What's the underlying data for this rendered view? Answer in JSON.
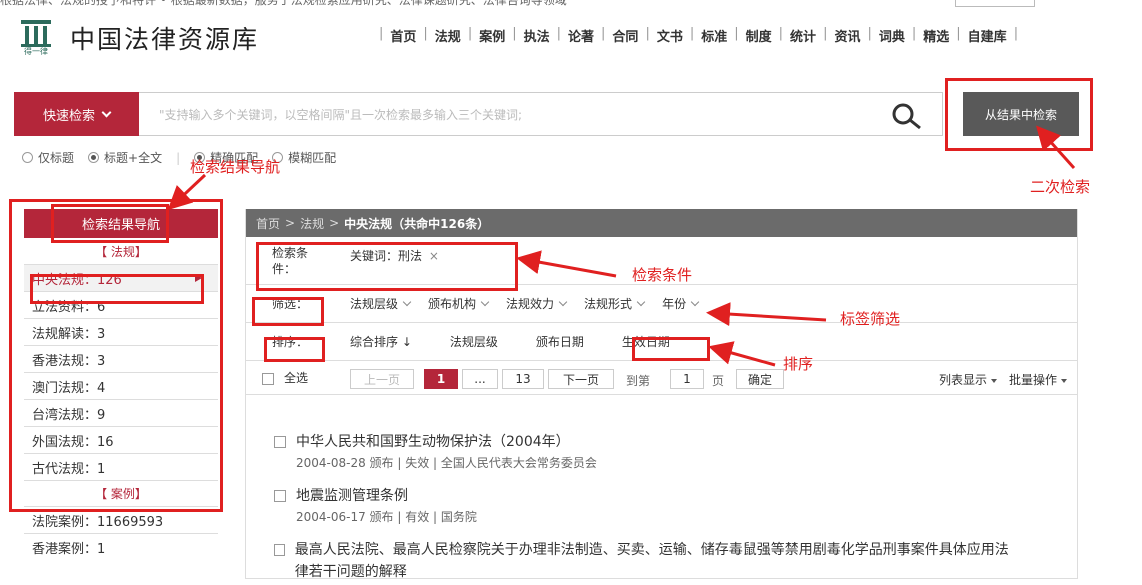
{
  "top_strip": {
    "text": "根据法律、法规的授予和特许 • 根据最新数据，服务于法规检索应用研究、法律课题研究、法律咨询等领域"
  },
  "logo": {
    "subtext": "得一律",
    "name": "中国法律资源库"
  },
  "topnav": [
    "首页",
    "法规",
    "案例",
    "执法",
    "论著",
    "合同",
    "文书",
    "标准",
    "制度",
    "统计",
    "资讯",
    "词典",
    "精选",
    "自建库"
  ],
  "search": {
    "quick_label": "快速检索",
    "placeholder": "\"支持输入多个关键词，以空格间隔\"且一次检索最多输入三个关键词;",
    "secondary_button": "从结果中检索",
    "options": [
      {
        "label": "仅标题",
        "checked": false
      },
      {
        "label": "标题+全文",
        "checked": true
      },
      {
        "label": "精确匹配",
        "checked": true
      },
      {
        "label": "模糊匹配",
        "checked": false
      }
    ]
  },
  "sidebar": {
    "title": "检索结果导航",
    "cat1": "【 法规】",
    "items": [
      {
        "label": "中央法规：126"
      },
      {
        "label": "立法资料：6"
      },
      {
        "label": "法规解读：3"
      },
      {
        "label": "香港法规：3"
      },
      {
        "label": "澳门法规：4"
      },
      {
        "label": "台湾法规：9"
      },
      {
        "label": "外国法规：16"
      },
      {
        "label": "古代法规：1"
      }
    ],
    "cat2": "【 案例】",
    "case_items": [
      {
        "label": "法院案例：11669593"
      },
      {
        "label": "香港案例：1"
      }
    ]
  },
  "breadcrumb": {
    "home": "首页",
    "sep": ">",
    "level1": "法规",
    "current": "中央法规（共命中126条）"
  },
  "conditions": {
    "label": "检索条件：",
    "value": "关键词：刑法",
    "remove": "×"
  },
  "filter": {
    "label": "筛选：",
    "items": [
      "法规层级",
      "颁布机构",
      "法规效力",
      "法规形式",
      "年份"
    ]
  },
  "sort": {
    "label": "排序：",
    "items": [
      "综合排序 ↓",
      "法规层级",
      "颁布日期",
      "生效日期"
    ]
  },
  "pager": {
    "select_all": "全选",
    "prev": "上一页",
    "current": "1",
    "ellipsis": "...",
    "last": "13",
    "next": "下一页",
    "goto_label": "到第",
    "goto_value": "1",
    "page_unit": "页",
    "confirm": "确定",
    "list_display": "列表显示",
    "batch": "批量操作"
  },
  "results": [
    {
      "title": "中华人民共和国野生动物保护法（2004年）",
      "meta": "2004-08-28 颁布 | 失效 | 全国人民代表大会常务委员会"
    },
    {
      "title": "地震监测管理条例",
      "meta": "2004-06-17 颁布 | 有效 | 国务院"
    },
    {
      "title": "最高人民法院、最高人民检察院关于办理非法制造、买卖、运输、储存毒鼠强等禁用剧毒化学品刑事案件具体应用法律若干问题的解释",
      "meta": ""
    }
  ],
  "annotations": {
    "nav_label": "检索结果导航",
    "secondary_label": "二次检索",
    "cond_label": "检索条件",
    "filter_label": "标签筛选",
    "sort_label": "排序"
  },
  "colors": {
    "brand_red": "#b4263a",
    "annotation_red": "#e02020",
    "breadcrumb_bg": "#6b6b6b",
    "button_gray": "#595959"
  }
}
